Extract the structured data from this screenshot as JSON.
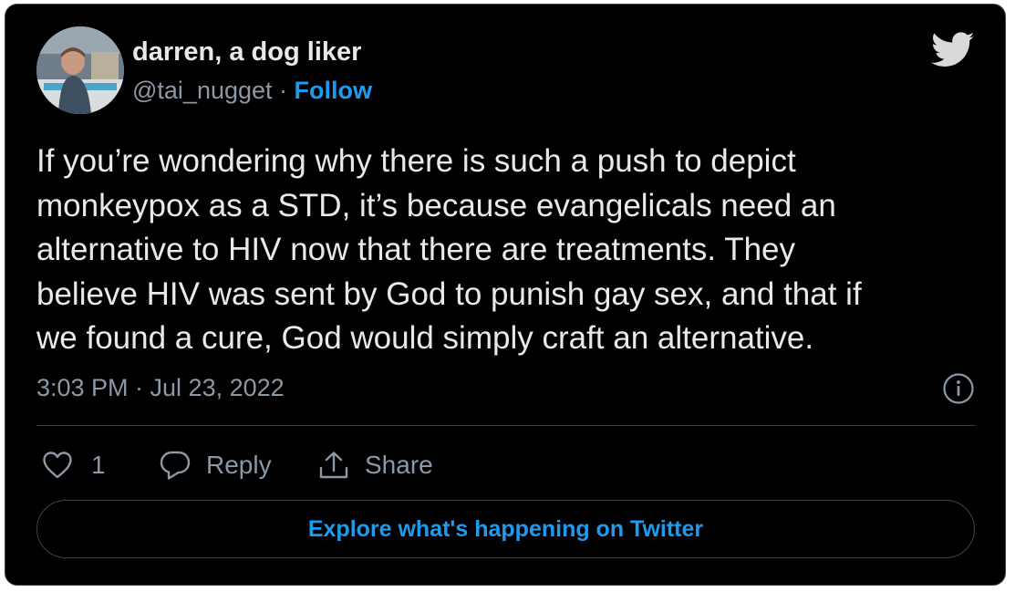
{
  "author": {
    "display_name": "darren, a dog liker",
    "handle": "@tai_nugget",
    "separator": " · ",
    "follow_label": "Follow"
  },
  "tweet": {
    "text": "If you’re wondering why there is such a push to depict\nmonkeypox as a STD, it’s because evangelicals need an\nalternative to HIV now that there are treatments. They\nbelieve HIV was sent by God to punish gay sex, and that if\nwe found a cure, God would simply craft an alternative.",
    "timestamp": "3:03 PM · Jul 23, 2022"
  },
  "actions": {
    "like_count": "1",
    "reply_label": "Reply",
    "share_label": "Share"
  },
  "explore_button_label": "Explore what's happening on Twitter",
  "icons": {
    "brand": "twitter-bird-icon",
    "info": "info-icon",
    "like": "heart-icon",
    "reply": "speech-bubble-icon",
    "share": "share-upload-icon"
  },
  "colors": {
    "background": "#000000",
    "text": "#e7e9ea",
    "secondary_text": "#8b98a5",
    "accent": "#1d9bf0",
    "border": "#3a3f44"
  }
}
